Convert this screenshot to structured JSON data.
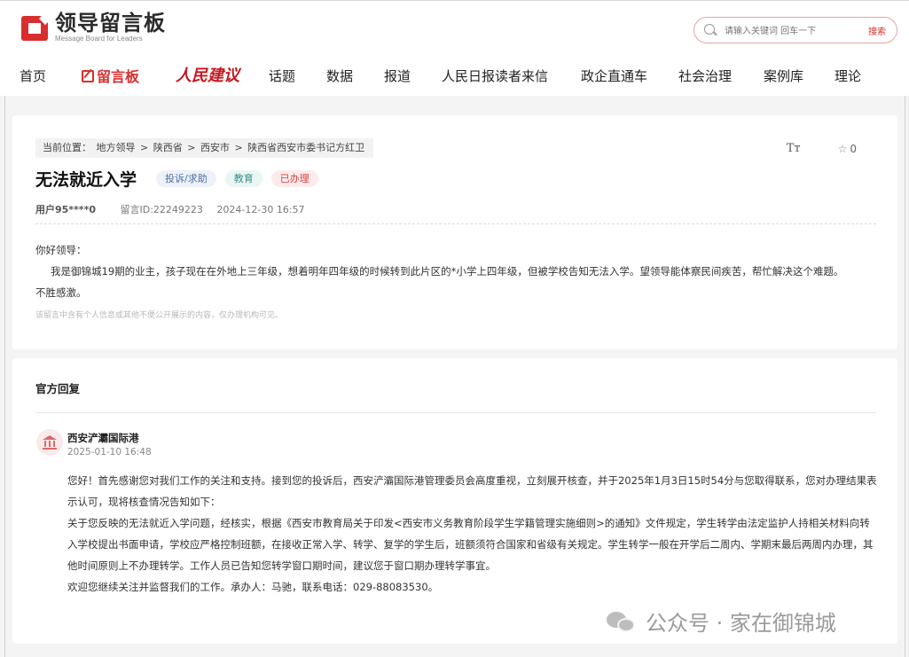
{
  "header": {
    "logo_cn": "领导留言板",
    "logo_en": "Message Board for Leaders",
    "search_placeholder": "请输入关键词 回车一下",
    "search_button": "搜索"
  },
  "nav": {
    "items": [
      "首页",
      "留言板",
      "人民建议",
      "话题",
      "数据",
      "报道",
      "人民日报读者来信",
      "政企直通车",
      "社会治理",
      "案例库",
      "理论"
    ]
  },
  "breadcrumb": {
    "prefix": "当前位置：",
    "items": [
      "地方领导",
      "陕西省",
      "西安市",
      "陕西省西安市委书记方红卫"
    ],
    "sep": ">"
  },
  "tools": {
    "font_size": "Tт",
    "star_icon": "star-icon",
    "star_count": "0"
  },
  "message": {
    "title": "无法就近入学",
    "tags": [
      "投诉/求助",
      "教育",
      "已办理"
    ],
    "user": "用户95****0",
    "id_label": "留言ID:22249223",
    "datetime": "2024-12-30 16:57",
    "greeting": "你好领导：",
    "body_line1": "我是御锦城19期的业主，孩子现在在外地上三年级，想着明年四年级的时候转到此片区的*小学上四年级，但被学校告知无法入学。望领导能体察民间疾苦，帮忙解决这个难题。",
    "body_line2": "不胜感激。",
    "note": "该留言中含有个人信息或其他不便公开展示的内容，仅办理机构可见。"
  },
  "reply": {
    "section_title": "官方回复",
    "org_name": "西安浐灞国际港",
    "datetime": "2025-01-10 16:48",
    "para1": "您好！首先感谢您对我们工作的关注和支持。接到您的投诉后，西安浐灞国际港管理委员会高度重视，立刻展开核查，并于2025年1月3日15时54分与您取得联系，您对办理结果表示认可，现将核查情况告知如下：",
    "para2": "关于您反映的无法就近入学问题，经核实，根据《西安市教育局关于印发<西安市义务教育阶段学生学籍管理实施细则>的通知》文件规定，学生转学由法定监护人持相关材料向转入学校提出书面申请，学校应严格控制班额，在接收正常入学、转学、复学的学生后，班额须符合国家和省级有关规定。学生转学一般在开学后二周内、学期末最后两周内办理，其他时间原则上不办理转学。工作人员已告知您转学窗口期时间，建议您于窗口期办理转学事宜。",
    "para3": "欢迎您继续关注并监督我们的工作。承办人：马驰，联系电话：029-88083530。"
  },
  "watermark": {
    "text": "公众号 · 家在御锦城"
  },
  "colors": {
    "brand_red": "#d92e2e",
    "page_bg": "#f4f4f4"
  }
}
